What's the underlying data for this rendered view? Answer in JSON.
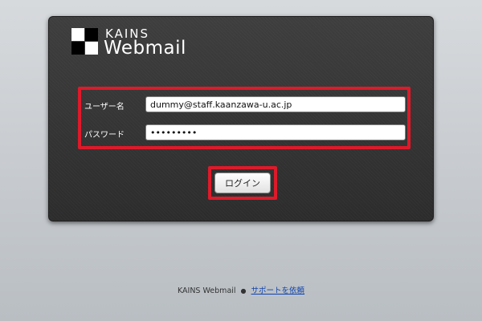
{
  "logo": {
    "line1": "KAINS",
    "line2": "Webmail",
    "colors": {
      "light": "#ffffff",
      "dark": "#000000"
    }
  },
  "form": {
    "username_label": "ユーザー名",
    "username_value": "dummy@staff.kaanzawa-u.ac.jp",
    "password_label": "パスワード",
    "password_value": "dummypass",
    "login_label": "ログイン"
  },
  "highlight_color": "#dd1a2a",
  "footer": {
    "app_name": "KAINS Webmail",
    "separator": "●",
    "support_link": "サポートを依頼"
  }
}
